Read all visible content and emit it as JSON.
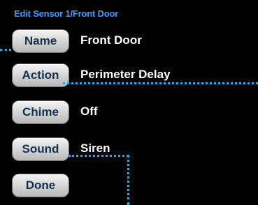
{
  "header": {
    "title": "Edit Sensor 1/Front Door"
  },
  "rows": [
    {
      "button_label": "Name",
      "value": "Front Door"
    },
    {
      "button_label": "Action",
      "value": "Perimeter Delay"
    },
    {
      "button_label": "Chime",
      "value": "Off"
    },
    {
      "button_label": "Sound",
      "value": "Siren"
    }
  ],
  "done_button": {
    "label": "Done"
  },
  "colors": {
    "title": "#3b9cff",
    "button_text": "#14304c",
    "value_text": "#ffffff",
    "callout_line": "#27a9e8",
    "background": "#000000"
  }
}
